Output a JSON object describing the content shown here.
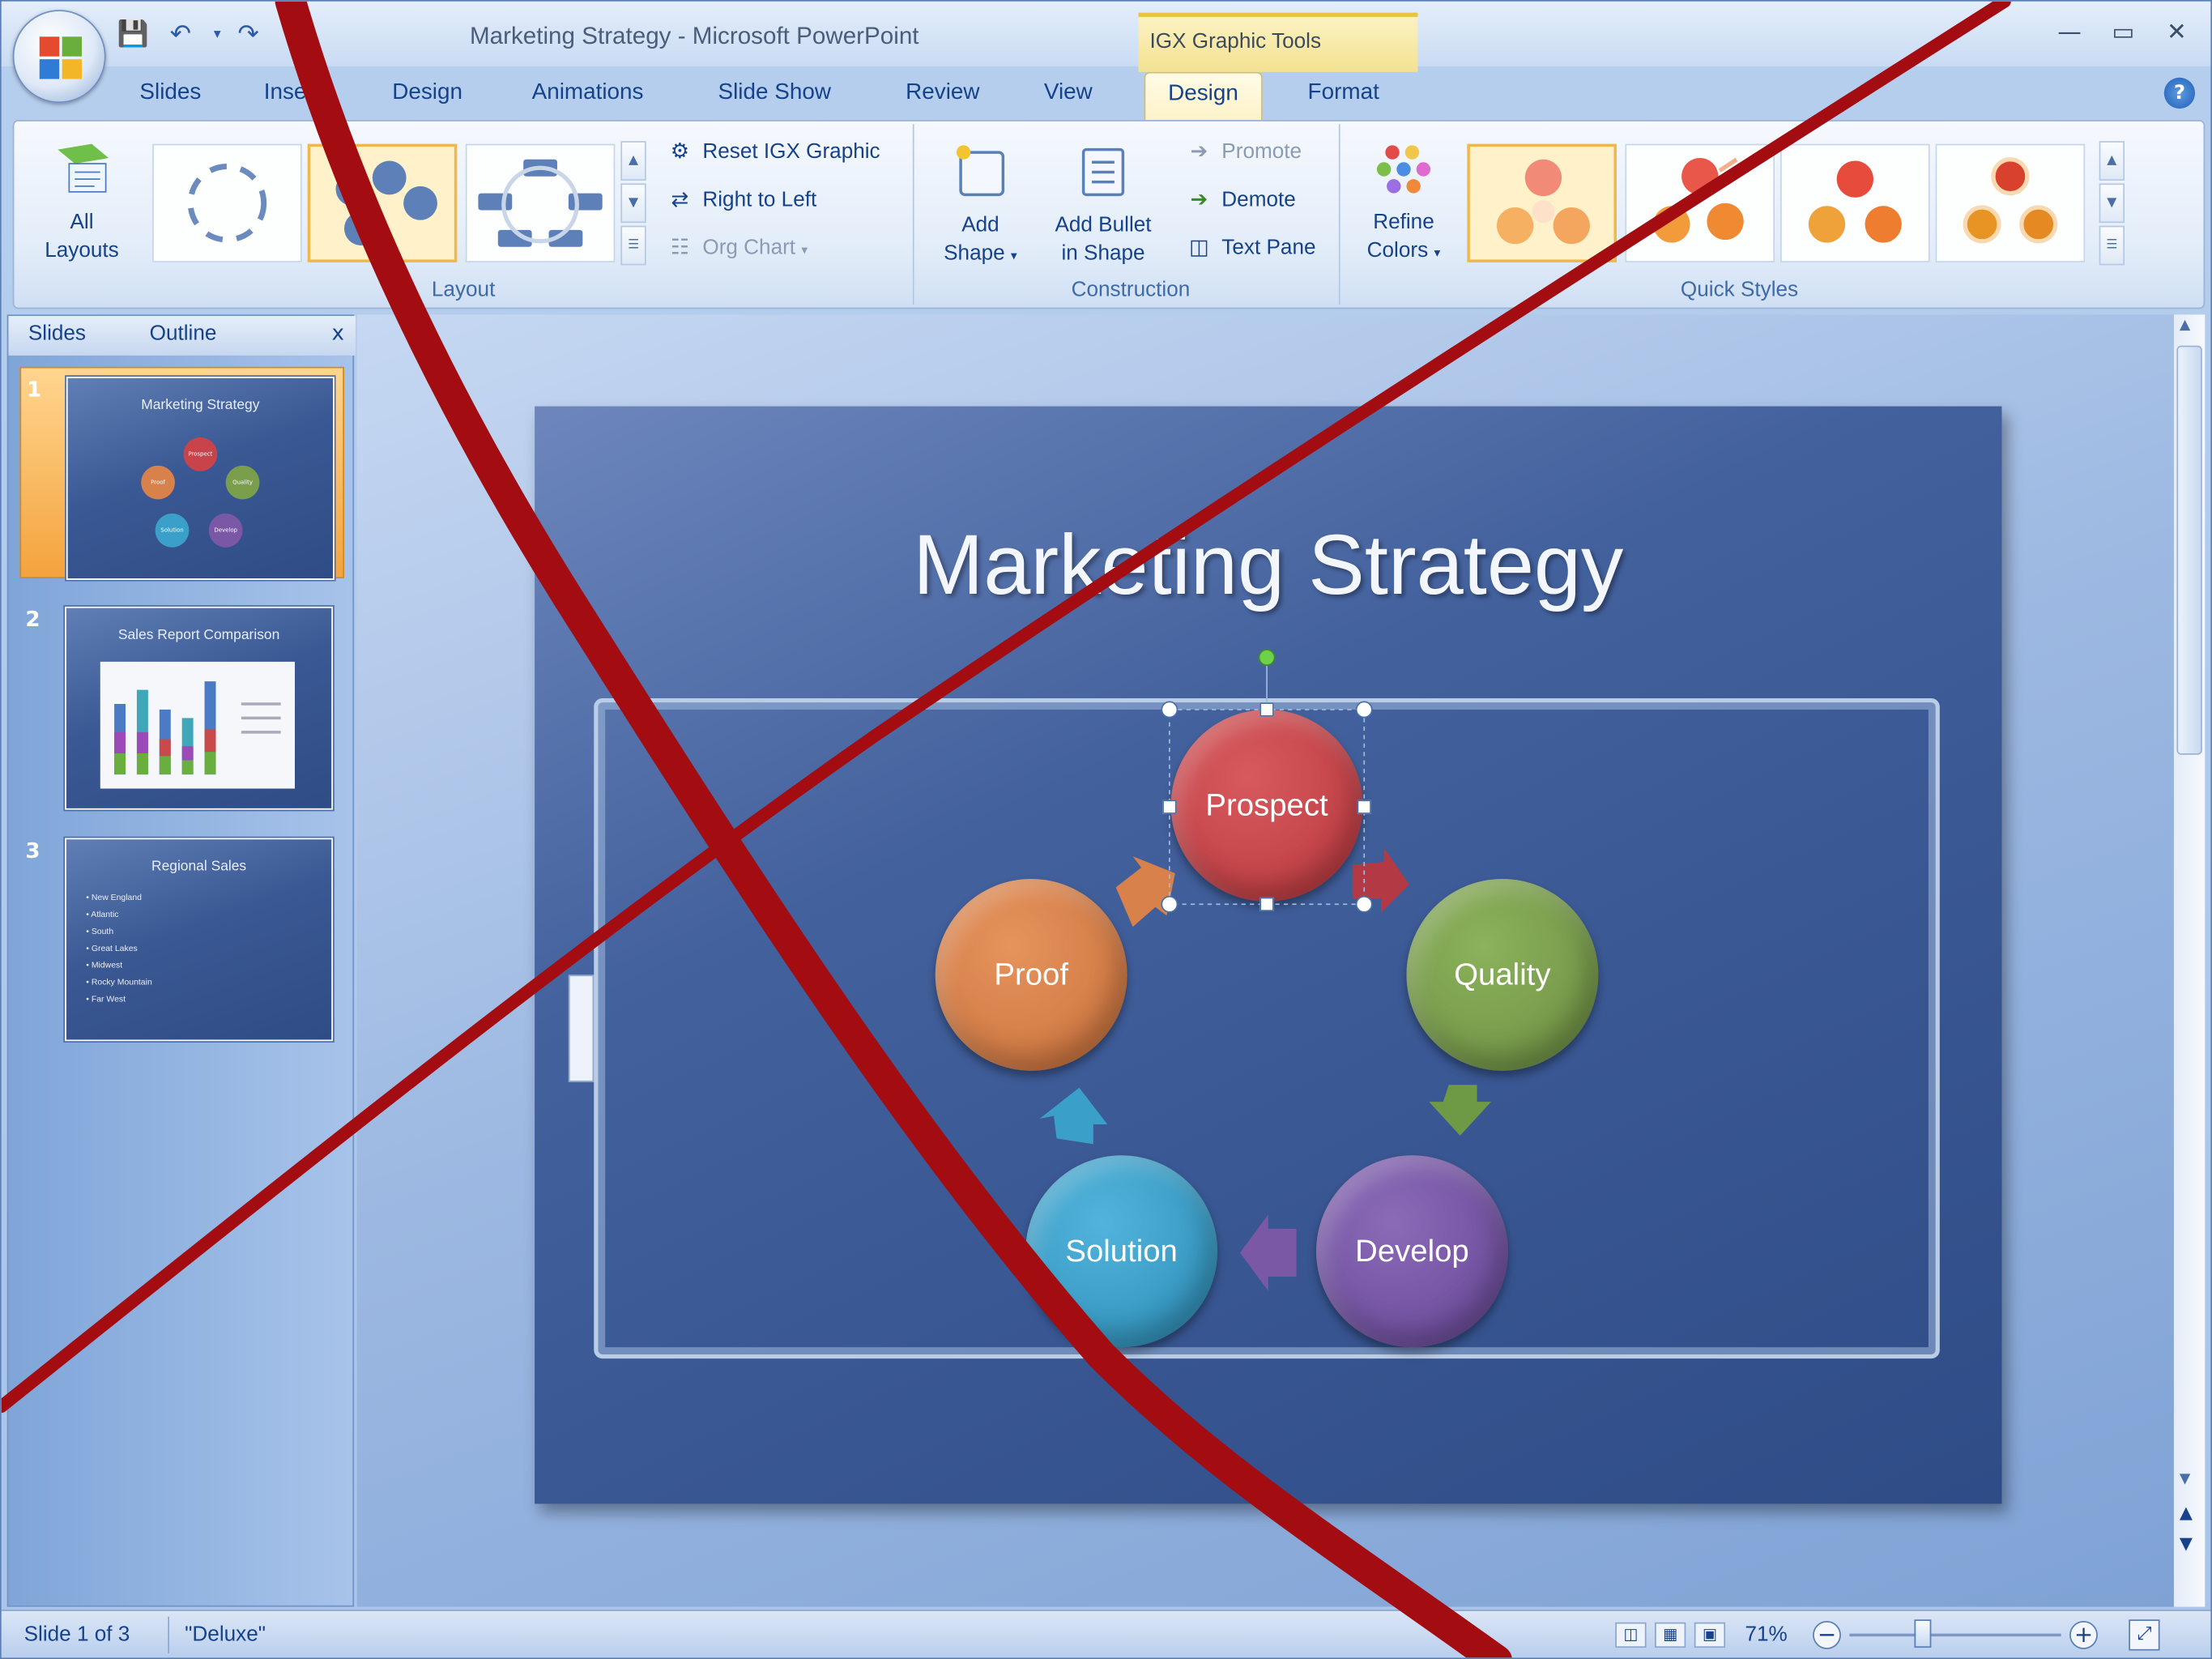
{
  "window": {
    "title": "Marketing Strategy - Microsoft PowerPoint",
    "contextual_group": "IGX Graphic Tools",
    "minimize_icon": "minimize-icon",
    "maximize_icon": "maximize-icon",
    "close_icon": "close-icon"
  },
  "tabs": [
    "Slides",
    "Insert",
    "Design",
    "Animations",
    "Slide Show",
    "Review",
    "View",
    "Design",
    "Format"
  ],
  "active_tab": "Design",
  "ribbon": {
    "layout": {
      "all_layouts_line1": "All",
      "all_layouts_line2": "Layouts",
      "group_label": "Layout"
    },
    "reset": "Reset IGX Graphic",
    "right_to_left": "Right to Left",
    "org_chart": "Org Chart",
    "construction": {
      "add_shape_line1": "Add",
      "add_shape_line2": "Shape",
      "add_bullet_line1": "Add Bullet",
      "add_bullet_line2": "in Shape",
      "promote": "Promote",
      "demote": "Demote",
      "text_pane": "Text Pane",
      "group_label": "Construction"
    },
    "quick_styles": {
      "refine_line1": "Refine",
      "refine_line2": "Colors",
      "group_label": "Quick Styles"
    }
  },
  "left_pane": {
    "tab_slides": "Slides",
    "tab_outline": "Outline",
    "close": "x",
    "thumbnails": [
      {
        "number": "1",
        "title": "Marketing Strategy",
        "nodes": [
          "Prospect",
          "Quality",
          "Develop",
          "Solution",
          "Proof"
        ]
      },
      {
        "number": "2",
        "title": "Sales Report Comparison"
      },
      {
        "number": "3",
        "title": "Regional Sales",
        "bullets": [
          "New England",
          "Atlantic",
          "South",
          "Great Lakes",
          "Midwest",
          "Rocky Mountain",
          "Far West"
        ]
      }
    ]
  },
  "slide": {
    "title": "Marketing Strategy",
    "nodes": [
      {
        "label": "Prospect",
        "color": "#c8444a"
      },
      {
        "label": "Quality",
        "color": "#7a9e4c"
      },
      {
        "label": "Develop",
        "color": "#7a58a6"
      },
      {
        "label": "Solution",
        "color": "#3ba0c9"
      },
      {
        "label": "Proof",
        "color": "#d9814a"
      }
    ]
  },
  "status": {
    "slide_info": "Slide 1 of 3",
    "theme": "\"Deluxe\"",
    "zoom": "71%"
  },
  "overlay_color": "#a30d12"
}
